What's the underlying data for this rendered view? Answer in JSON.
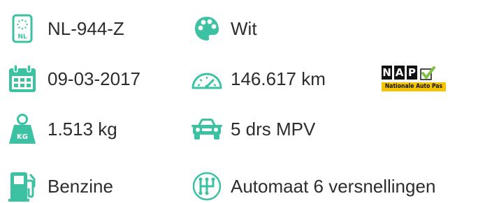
{
  "colors": {
    "accent": "#3cc2a2",
    "text": "#2d2d2d",
    "nap_yellow": "#f5c400",
    "nap_check": "#7dc242"
  },
  "specs": {
    "license_plate": {
      "icon": "license-plate-icon",
      "plate_badge": "NL",
      "value": "NL-944-Z"
    },
    "color": {
      "icon": "palette-icon",
      "value": "Wit"
    },
    "registration_date": {
      "icon": "calendar-icon",
      "value": "09-03-2017"
    },
    "mileage": {
      "icon": "speedometer-icon",
      "value": "146.617 km"
    },
    "weight": {
      "icon": "weight-icon",
      "badge": "KG",
      "value": "1.513 kg"
    },
    "body": {
      "icon": "car-icon",
      "value": "5 drs MPV"
    },
    "fuel": {
      "icon": "fuel-pump-icon",
      "value": "Benzine"
    },
    "transmission": {
      "icon": "gear-shift-icon",
      "value": "Automaat 6 versnellingen"
    }
  },
  "nap_logo": {
    "letters": [
      "N",
      "A",
      "P"
    ],
    "subtitle": "Nationale Auto Pas"
  }
}
